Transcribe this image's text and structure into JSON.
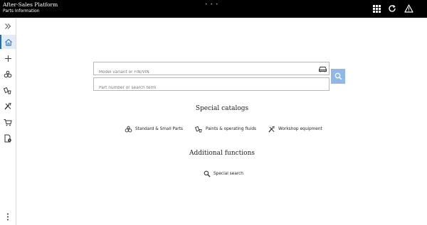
{
  "header": {
    "title": "After-Sales Platform",
    "subtitle": "Parts Information",
    "icons": [
      "apps-grid-icon",
      "refresh-icon",
      "warning-icon"
    ]
  },
  "sidebar": {
    "items": [
      {
        "name": "expand-sidebar",
        "icon": "double-chevron-right-icon"
      },
      {
        "name": "home",
        "icon": "home-icon",
        "active": true
      },
      {
        "name": "add",
        "icon": "plus-icon"
      },
      {
        "name": "standard-parts",
        "icon": "gears-icon"
      },
      {
        "name": "paints-fluids",
        "icon": "paint-bucket-icon"
      },
      {
        "name": "workshop-equipment",
        "icon": "tools-icon"
      },
      {
        "name": "cart",
        "icon": "cart-icon"
      },
      {
        "name": "document-info",
        "icon": "document-icon"
      },
      {
        "name": "more",
        "icon": "vertical-dots-icon"
      }
    ]
  },
  "search": {
    "vin_placeholder": "Model variant or FIN/VIN",
    "part_placeholder": "Part number or search term"
  },
  "special_catalogs": {
    "title": "Special catalogs",
    "links": [
      "Standard & Small Parts",
      "Paints & operating fluids",
      "Workshop equipment"
    ]
  },
  "additional_functions": {
    "title": "Additional functions",
    "links": [
      "Special search"
    ]
  },
  "colors": {
    "header_bg": "#000000",
    "accent": "#1f6fb2",
    "search_button": "#8fb8e6"
  }
}
